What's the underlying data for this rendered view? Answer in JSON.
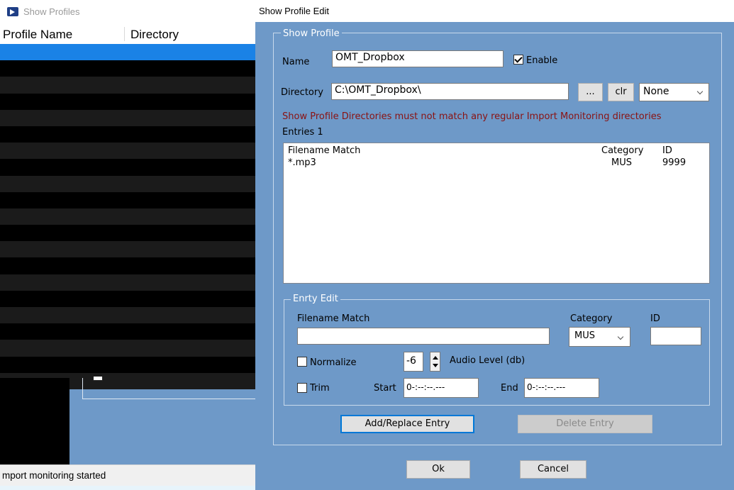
{
  "left_window": {
    "title": "Show Profiles",
    "columns": [
      "Profile Name",
      "Directory"
    ],
    "status": "mport monitoring started"
  },
  "edit_dialog": {
    "title": "Show Profile Edit",
    "group_title": "Show Profile",
    "name_label": "Name",
    "name_value": "OMT_Dropbox",
    "enable_label": "Enable",
    "enable_checked": true,
    "directory_label": "Directory",
    "directory_value": "C:\\OMT_Dropbox\\",
    "browse_label": "...",
    "clear_label": "clr",
    "directory_option": "None",
    "warning": "Show Profile Directories must not match any regular Import Monitoring directories",
    "entries_label": "Entries 1",
    "entries_columns": [
      "Filename Match",
      "Category",
      "ID"
    ],
    "entries": [
      {
        "filename": "*.mp3",
        "category": "MUS",
        "id": "9999"
      }
    ],
    "entry_edit": {
      "title": "Enrty Edit",
      "filename_label": "Filename Match",
      "filename_value": "",
      "category_label": "Category",
      "category_value": "MUS",
      "id_label": "ID",
      "id_value": "",
      "normalize_label": "Normalize",
      "normalize_checked": false,
      "audio_level_value": "-6",
      "audio_level_label": "Audio Level (db)",
      "trim_label": "Trim",
      "trim_checked": false,
      "start_label": "Start",
      "start_value": "0-:--:--.---",
      "end_label": "End",
      "end_value": "0-:--:--.---"
    },
    "add_replace_label": "Add/Replace Entry",
    "delete_label": "Delete Entry",
    "ok_label": "Ok",
    "cancel_label": "Cancel"
  },
  "colors": {
    "window_bg": "#6e99c8",
    "selection": "#1a82e6",
    "warning": "#8a1212"
  }
}
